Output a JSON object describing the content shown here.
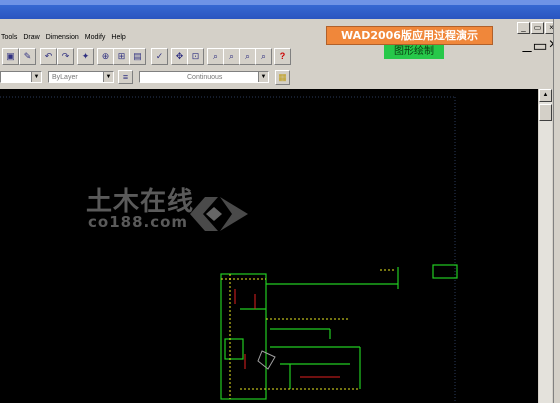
{
  "menu": {
    "items": [
      "Tools",
      "Draw",
      "Dimension",
      "Modify",
      "Help"
    ]
  },
  "window_buttons": {
    "top": [
      "_",
      "▭",
      "×"
    ],
    "doc": [
      "_",
      "▭",
      "×"
    ]
  },
  "banner": {
    "title": "WAD2006版应用过程演示",
    "subtitle": "图形绘制"
  },
  "properties": {
    "color_value": "",
    "layer_value": "ByLayer",
    "linetype_value": "Continuous"
  },
  "watermark": {
    "brand": "土木在线",
    "site": "co188.com"
  },
  "colors": {
    "canvas": "#000000",
    "banner": "#f0873a",
    "subbanner": "#27c84a",
    "drawing_green": "#22cc22",
    "drawing_yellow": "#e8e820",
    "drawing_red": "#e02020"
  },
  "icons": [
    "save-icon",
    "match-icon",
    "undo-icon",
    "redo-icon",
    "paint-icon",
    "snap-icon",
    "osnap-icon",
    "calc-icon",
    "properties-icon",
    "pan-icon",
    "zoom-realtime-icon",
    "zoom-window-icon",
    "zoom-previous-icon",
    "zoom-extents-icon",
    "help-icon"
  ]
}
